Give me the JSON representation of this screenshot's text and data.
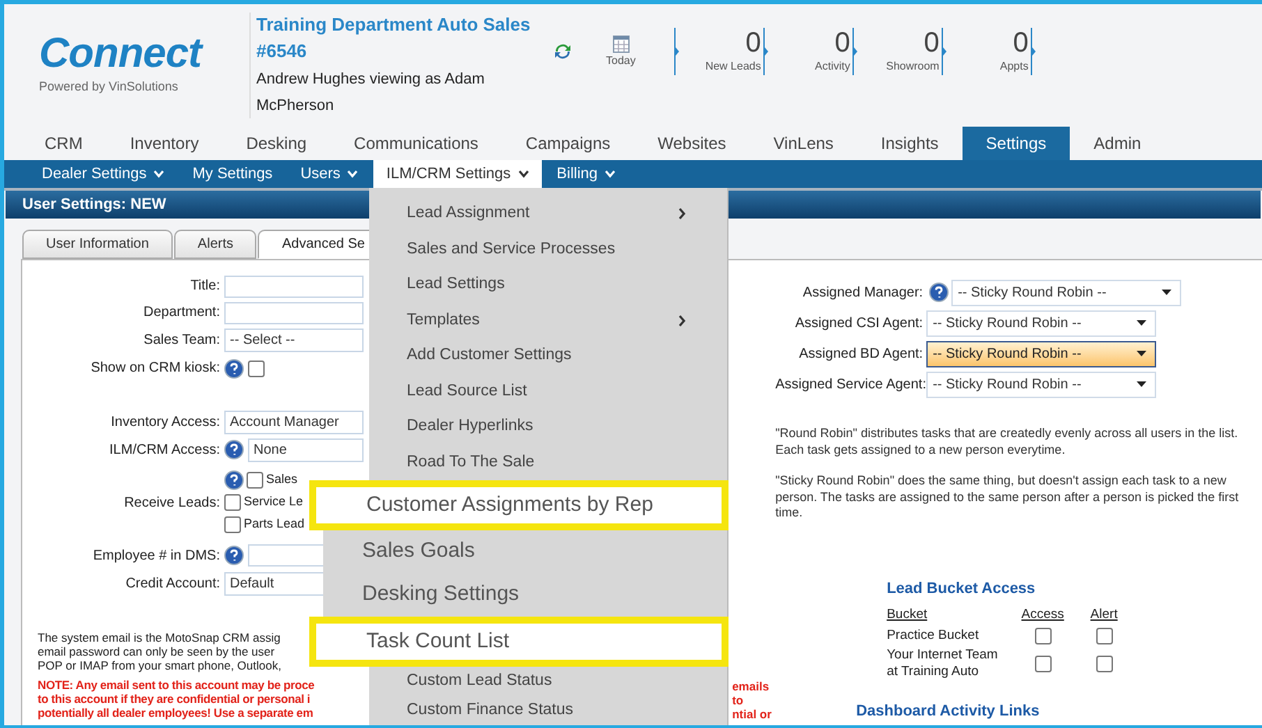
{
  "header": {
    "logo": "Connect",
    "tagline": "Powered by VinSolutions",
    "dealer": "Training Department Auto Sales",
    "dealer_number": "#6546",
    "user_line_1": "Andrew Hughes viewing as Adam",
    "user_line_2": "McPherson",
    "today": "Today"
  },
  "counters": [
    {
      "value": "0",
      "label": "New Leads"
    },
    {
      "value": "0",
      "label": "Activity"
    },
    {
      "value": "0",
      "label": "Showroom"
    },
    {
      "value": "0",
      "label": "Appts"
    }
  ],
  "main_tabs": [
    {
      "label": "CRM",
      "selected": false
    },
    {
      "label": "Inventory",
      "selected": false
    },
    {
      "label": "Desking",
      "selected": false
    },
    {
      "label": "Communications",
      "selected": false
    },
    {
      "label": "Campaigns",
      "selected": false
    },
    {
      "label": "Websites",
      "selected": false
    },
    {
      "label": "VinLens",
      "selected": false
    },
    {
      "label": "Insights",
      "selected": false
    },
    {
      "label": "Settings",
      "selected": true
    },
    {
      "label": "Admin",
      "selected": false
    }
  ],
  "sub_nav": [
    {
      "label": "Dealer Settings",
      "dropdown": true,
      "selected": false
    },
    {
      "label": "My Settings",
      "dropdown": false,
      "selected": false
    },
    {
      "label": "Users",
      "dropdown": true,
      "selected": false
    },
    {
      "label": "ILM/CRM Settings",
      "dropdown": true,
      "selected": true
    },
    {
      "label": "Billing",
      "dropdown": true,
      "selected": false
    }
  ],
  "section_title": "User Settings: NEW",
  "form_tabs": [
    {
      "label": "User Information",
      "selected": false
    },
    {
      "label": "Alerts",
      "selected": false
    },
    {
      "label": "Advanced Se",
      "selected": true
    }
  ],
  "left_form_top": [
    {
      "kind": "text",
      "label": "Title:",
      "help": false
    },
    {
      "kind": "text",
      "label": "Department:",
      "help": false
    },
    {
      "kind": "select",
      "label": "Sales Team:",
      "value": "-- Select --",
      "help": false
    },
    {
      "kind": "checkbox",
      "label": "Show on CRM kiosk:",
      "help": true,
      "checked": false
    }
  ],
  "left_form_bottom": [
    {
      "kind": "select",
      "label": "Inventory Access:",
      "value": "Account Manager",
      "help": false
    },
    {
      "kind": "select",
      "label": "ILM/CRM Access:",
      "value": "None",
      "help": true
    },
    {
      "kind": "checklist",
      "label": "Receive Leads:",
      "help": true,
      "options": [
        {
          "label": "Sales",
          "checked": false
        },
        {
          "label": "Service Le",
          "checked": false
        },
        {
          "label": "Parts Lead",
          "checked": false
        }
      ]
    },
    {
      "kind": "text",
      "label": "Employee # in DMS:",
      "help": true
    },
    {
      "kind": "select",
      "label": "Credit Account:",
      "value": "Default",
      "help": false
    }
  ],
  "email_note": [
    "The system email is the MotoSnap CRM assig",
    "email password can only be seen by the user",
    "POP or IMAP from your smart phone, Outlook,"
  ],
  "warning": [
    {
      "left": "NOTE: Any email sent to this account may be proce",
      "right": "emails"
    },
    {
      "left": "to this account if they are confidential or personal i",
      "right": "to"
    },
    {
      "left": "potentially all dealer employees! Use a separate em",
      "right": "ntial or"
    }
  ],
  "right_form": [
    {
      "label": "Assigned Manager:",
      "value": "-- Sticky Round Robin --",
      "help": true,
      "highlighted": false
    },
    {
      "label": "Assigned CSI Agent:",
      "value": "-- Sticky Round Robin --",
      "help": false,
      "highlighted": false
    },
    {
      "label": "Assigned BD Agent:",
      "value": "-- Sticky Round Robin --",
      "help": false,
      "highlighted": true
    },
    {
      "label": "Assigned Service Agent:",
      "value": "-- Sticky Round Robin --",
      "help": false,
      "highlighted": false
    }
  ],
  "info": [
    "\"Round Robin\" distributes tasks that are createdly evenly across all users in the list. Each task gets assigned to a new person everytime.",
    "\"Sticky Round Robin\" does the same thing, but doesn't assign each task to a new person. The tasks are assigned to the same person after a person is picked the first time."
  ],
  "lead_bucket": {
    "title": "Lead Bucket Access",
    "columns": [
      "Bucket",
      "Access",
      "Alert"
    ],
    "rows": [
      {
        "name": "Practice Bucket",
        "access": false,
        "alert": false
      },
      {
        "name": "Your Internet Team at Training Auto",
        "access": false,
        "alert": false
      }
    ]
  },
  "dashboard_title": "Dashboard Activity Links",
  "menu": [
    {
      "label": "Lead Assignment",
      "kind": "item",
      "has_submenu": true
    },
    {
      "label": "Sales and Service Processes",
      "kind": "item",
      "has_submenu": false
    },
    {
      "label": "Lead Settings",
      "kind": "item",
      "has_submenu": false
    },
    {
      "label": "Templates",
      "kind": "item",
      "has_submenu": true
    },
    {
      "label": "Add Customer Settings",
      "kind": "item",
      "has_submenu": false
    },
    {
      "label": "Lead Source List",
      "kind": "item",
      "has_submenu": false
    },
    {
      "label": "Dealer Hyperlinks",
      "kind": "item",
      "has_submenu": false
    },
    {
      "label": "Road To The Sale",
      "kind": "item",
      "has_submenu": false
    },
    {
      "label": "Customer Assignments by Rep",
      "kind": "highlight",
      "has_submenu": false
    },
    {
      "label": "Sales Goals",
      "kind": "large",
      "has_submenu": false
    },
    {
      "label": "Desking Settings",
      "kind": "large",
      "has_submenu": false
    },
    {
      "label": "Task Count List",
      "kind": "highlight",
      "has_submenu": false
    },
    {
      "label": "Custom Lead Status",
      "kind": "item",
      "has_submenu": false
    },
    {
      "label": "Custom Finance Status",
      "kind": "item",
      "has_submenu": false
    }
  ]
}
